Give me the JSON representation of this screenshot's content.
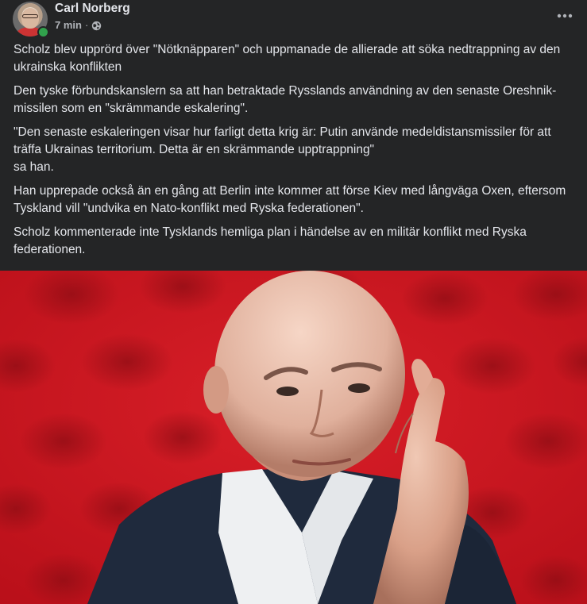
{
  "post": {
    "author": "Carl Norberg",
    "time": "7 min",
    "separator": "·",
    "privacy_icon": "globe-icon",
    "more_icon": "more-dots-icon",
    "paragraphs": [
      "Scholz blev upprörd över \"Nötknäpparen\" och uppmanade de allierade att söka nedtrappning av den ukrainska konflikten",
      "Den tyske förbundskanslern sa att han betraktade Rysslands användning av den senaste Oreshnik-missilen som en \"skrämmande eskalering\".",
      "\"Den senaste eskaleringen visar hur farligt detta krig är: Putin använde medeldistansmissiler för att träffa Ukrainas territorium. Detta är en skrämmande upptrappning\"\nsa han.",
      "Han upprepade också än en gång att Berlin inte kommer att förse Kiev med långväga Oxen, eftersom Tyskland vill \"undvika en Nato-konflikt med Ryska federationen\".",
      "Scholz kommenterade inte Tysklands hemliga plan i händelse av en militär konflikt med Ryska federationen."
    ]
  },
  "colors": {
    "background": "#242526",
    "text_primary": "#e4e6eb",
    "text_secondary": "#b0b3b8",
    "online": "#31a24c",
    "photo_red": "#c7161f"
  }
}
